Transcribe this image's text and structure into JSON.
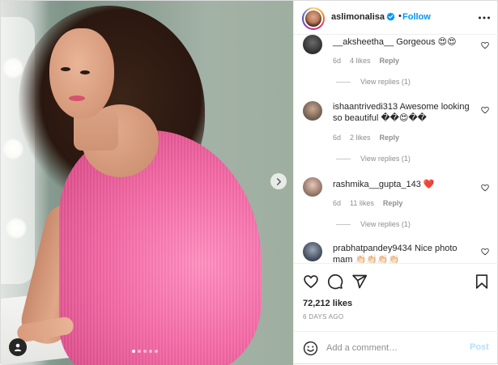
{
  "post": {
    "username": "aslimonalisa",
    "separator": "•",
    "follow_label": "Follow",
    "carousel_dot_count": 5,
    "carousel_active_index": 0
  },
  "comments": [
    {
      "username": "__aksheetha__",
      "text": "Gorgeous 😍😍",
      "time": "6d",
      "likes": "4 likes",
      "reply_label": "Reply",
      "view_replies": "View replies (1)"
    },
    {
      "username": "ishaantrivedi313",
      "text": "Awesome looking so beautiful ��😍��",
      "time": "6d",
      "likes": "2 likes",
      "reply_label": "Reply",
      "view_replies": "View replies (1)"
    },
    {
      "username": "rashmika__gupta_143",
      "text": "❤️",
      "time": "6d",
      "likes": "11 likes",
      "reply_label": "Reply",
      "view_replies": "View replies (1)"
    },
    {
      "username": "prabhatpandey9434",
      "text": "Nice photo mam 👏🏻👏🏻👏🏻👏🏻"
    }
  ],
  "actions": {
    "likes_count": "72,212 likes",
    "date": "6 DAYS AGO"
  },
  "add_comment": {
    "placeholder": "Add a comment…",
    "post_label": "Post"
  },
  "colors": {
    "accent": "#0095f6",
    "post_disabled": "#b2dffc",
    "secondary_text": "#8e8e8e",
    "primary_text": "#262626",
    "heart_red": "#ed4956"
  },
  "icons": {
    "verified": "verified-badge-icon",
    "more": "more-options-icon",
    "next": "chevron-right-icon",
    "user_tag": "user-tag-icon",
    "like": "heart-icon",
    "comment": "comment-bubble-icon",
    "share": "paper-plane-icon",
    "save": "bookmark-icon",
    "emoji": "emoji-smile-icon",
    "comment_like": "small-heart-icon"
  }
}
